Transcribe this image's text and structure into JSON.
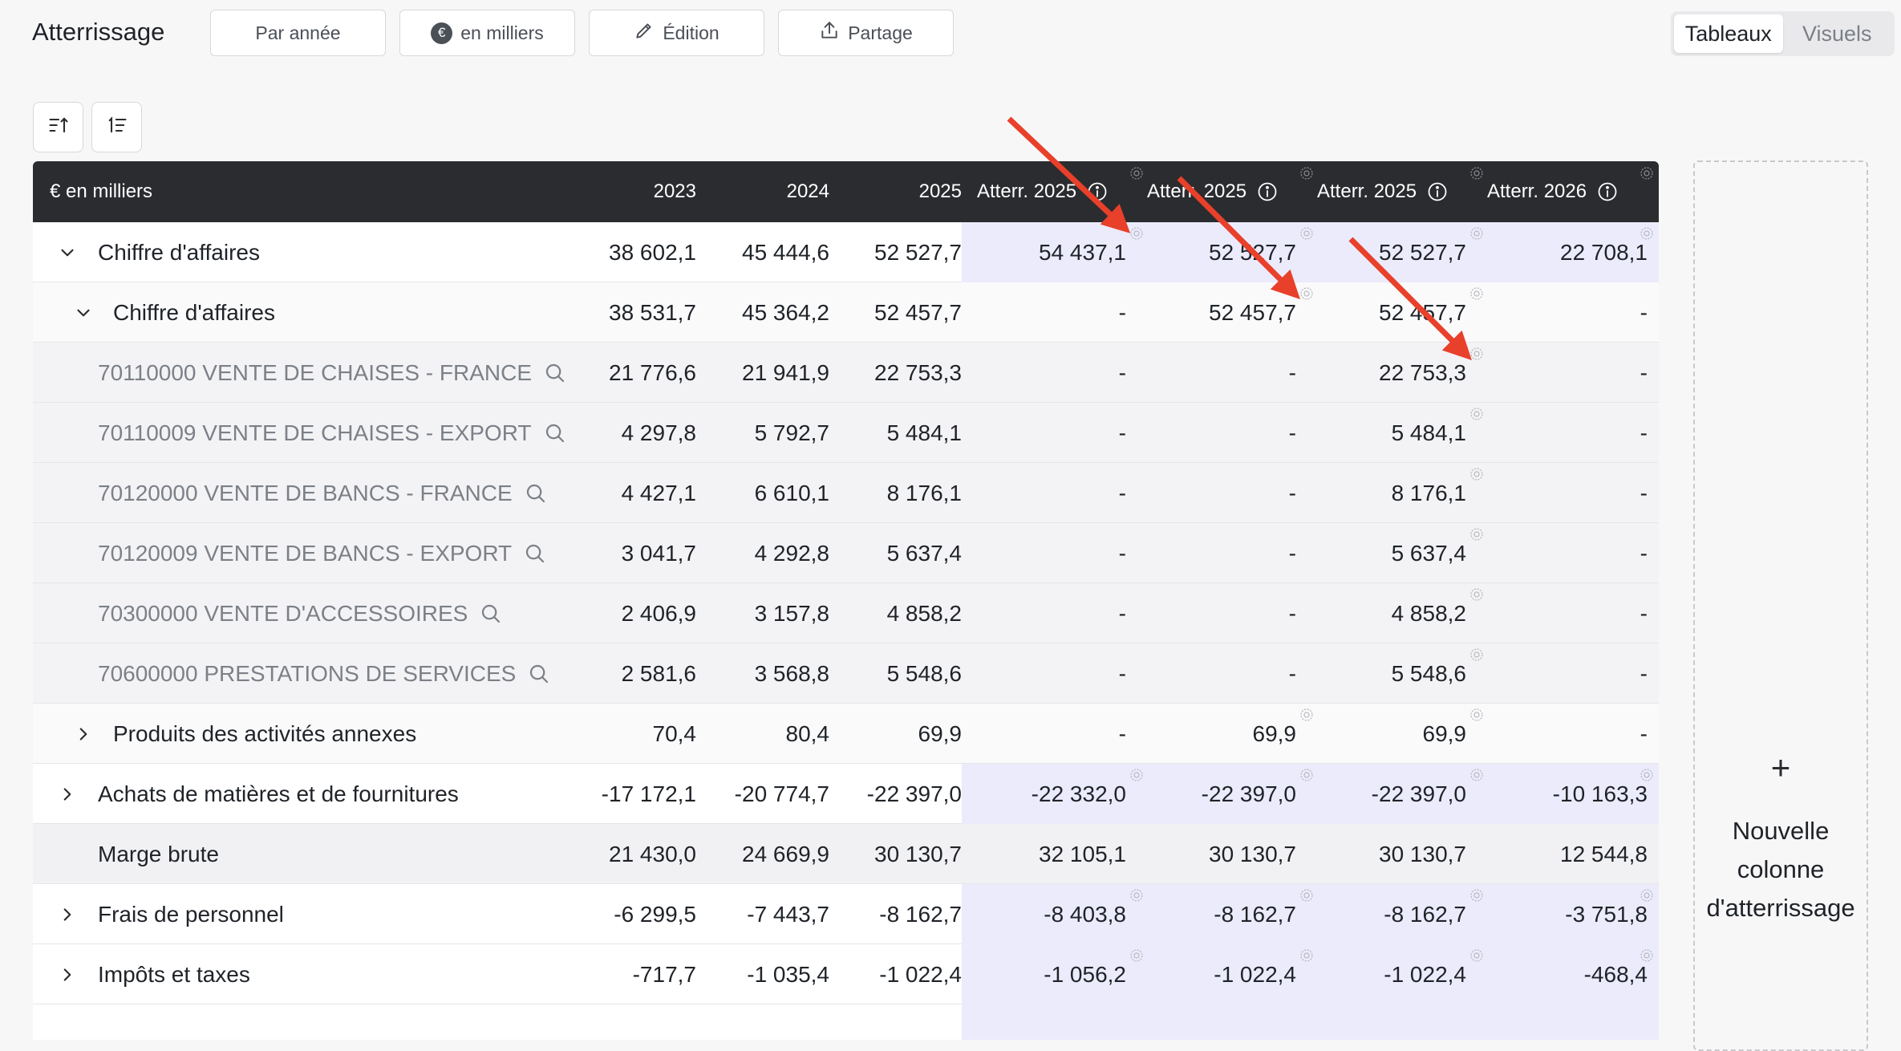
{
  "page": {
    "title": "Atterrissage"
  },
  "toolbar": {
    "by_year": "Par année",
    "currency_label": "en milliers",
    "currency_symbol": "€",
    "edit": "Édition",
    "share": "Partage"
  },
  "view_toggle": {
    "tables": "Tableaux",
    "visuals": "Visuels",
    "active": "Tableaux"
  },
  "table": {
    "header": {
      "unit": "€ en milliers",
      "columns": [
        "2023",
        "2024",
        "2025",
        "Atterr. 2025",
        "Atterr. 2025",
        "Atterr. 2025",
        "Atterr. 2026"
      ]
    },
    "rows": [
      {
        "label": "Chiffre d'affaires",
        "level": 0,
        "expand": "down",
        "values": [
          "38 602,1",
          "45 444,6",
          "52 527,7",
          "54 437,1",
          "52 527,7",
          "52 527,7",
          "22 708,1"
        ]
      },
      {
        "label": "Chiffre d'affaires",
        "level": 1,
        "expand": "down",
        "values": [
          "38 531,7",
          "45 364,2",
          "52 457,7",
          "-",
          "52 457,7",
          "52 457,7",
          "-"
        ]
      },
      {
        "label": "70110000 VENTE DE CHAISES - FRANCE",
        "level": 2,
        "values": [
          "21 776,6",
          "21 941,9",
          "22 753,3",
          "-",
          "-",
          "22 753,3",
          "-"
        ]
      },
      {
        "label": "70110009 VENTE DE CHAISES - EXPORT",
        "level": 2,
        "values": [
          "4 297,8",
          "5 792,7",
          "5 484,1",
          "-",
          "-",
          "5 484,1",
          "-"
        ]
      },
      {
        "label": "70120000 VENTE DE BANCS - FRANCE",
        "level": 2,
        "values": [
          "4 427,1",
          "6 610,1",
          "8 176,1",
          "-",
          "-",
          "8 176,1",
          "-"
        ]
      },
      {
        "label": "70120009 VENTE DE BANCS - EXPORT",
        "level": 2,
        "values": [
          "3 041,7",
          "4 292,8",
          "5 637,4",
          "-",
          "-",
          "5 637,4",
          "-"
        ]
      },
      {
        "label": "70300000 VENTE D'ACCESSOIRES",
        "level": 2,
        "values": [
          "2 406,9",
          "3 157,8",
          "4 858,2",
          "-",
          "-",
          "4 858,2",
          "-"
        ]
      },
      {
        "label": "70600000 PRESTATIONS DE SERVICES",
        "level": 2,
        "values": [
          "2 581,6",
          "3 568,8",
          "5 548,6",
          "-",
          "-",
          "5 548,6",
          "-"
        ]
      },
      {
        "label": "Produits des activités annexes",
        "level": 1,
        "expand": "right",
        "values": [
          "70,4",
          "80,4",
          "69,9",
          "-",
          "69,9",
          "69,9",
          "-"
        ]
      },
      {
        "label": "Achats de matières et de fournitures",
        "level": 0,
        "expand": "right",
        "values": [
          "-17 172,1",
          "-20 774,7",
          "-22 397,0",
          "-22 332,0",
          "-22 397,0",
          "-22 397,0",
          "-10 163,3"
        ]
      },
      {
        "label": "Marge brute",
        "level": 0,
        "total": true,
        "values": [
          "21 430,0",
          "24 669,9",
          "30 130,7",
          "32 105,1",
          "30 130,7",
          "30 130,7",
          "12 544,8"
        ]
      },
      {
        "label": "Frais de personnel",
        "level": 0,
        "expand": "right",
        "values": [
          "-6 299,5",
          "-7 443,7",
          "-8 162,7",
          "-8 403,8",
          "-8 162,7",
          "-8 162,7",
          "-3 751,8"
        ]
      },
      {
        "label": "Impôts et taxes",
        "level": 0,
        "expand": "right",
        "values": [
          "-717,7",
          "-1 035,4",
          "-1 022,4",
          "-1 056,2",
          "-1 022,4",
          "-1 022,4",
          "-468,4"
        ]
      }
    ]
  },
  "new_column": {
    "plus": "+",
    "line1": "Nouvelle",
    "line2": "colonne",
    "line3": "d'atterrissage"
  },
  "colors": {
    "header_bg": "#2b2c2f",
    "highlight_bg": "#ebebfc",
    "arrow": "#e8402a"
  },
  "icons": [
    "euro-icon",
    "pencil-icon",
    "share-icon",
    "sort-ascending-icon",
    "sort-numeric-icon",
    "info-icon",
    "gear-icon",
    "chevron-down-icon",
    "chevron-right-icon",
    "search-icon"
  ]
}
